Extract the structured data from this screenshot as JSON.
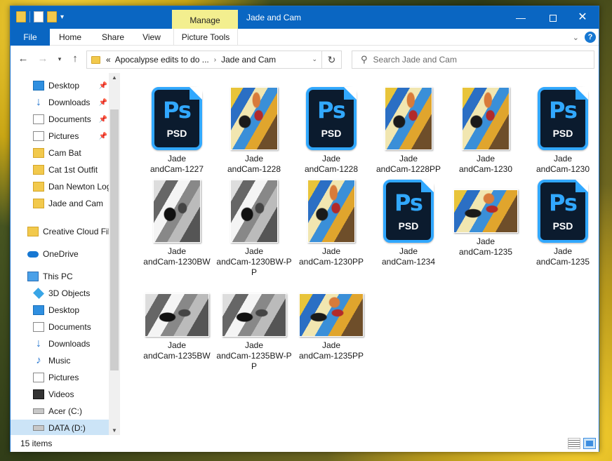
{
  "window": {
    "title": "Jade and Cam",
    "contextual_tab": "Manage"
  },
  "ribbon": {
    "tabs": [
      "File",
      "Home",
      "Share",
      "View",
      "Picture Tools"
    ]
  },
  "address": {
    "overflow": "«",
    "crumbs": [
      "Apocalypse edits to do ...",
      "Jade and Cam"
    ]
  },
  "search": {
    "placeholder": "Search Jade and Cam"
  },
  "nav": {
    "quick_access": [
      {
        "label": "Desktop",
        "icon": "desktop-icon",
        "pinned": true
      },
      {
        "label": "Downloads",
        "icon": "downloads-icon",
        "pinned": true
      },
      {
        "label": "Documents",
        "icon": "documents-icon",
        "pinned": true
      },
      {
        "label": "Pictures",
        "icon": "pictures-icon",
        "pinned": true
      },
      {
        "label": "Cam Bat",
        "icon": "folder-icon",
        "pinned": false
      },
      {
        "label": "Cat 1st Outfit",
        "icon": "folder-icon",
        "pinned": false
      },
      {
        "label": "Dan Newton Log",
        "icon": "folder-icon",
        "pinned": false
      },
      {
        "label": "Jade and Cam",
        "icon": "folder-icon",
        "pinned": false
      }
    ],
    "creative_cloud": "Creative Cloud Fil",
    "onedrive": "OneDrive",
    "this_pc": "This PC",
    "pc_items": [
      {
        "label": "3D Objects",
        "icon": "3d-objects-icon"
      },
      {
        "label": "Desktop",
        "icon": "desktop-icon"
      },
      {
        "label": "Documents",
        "icon": "documents-icon"
      },
      {
        "label": "Downloads",
        "icon": "downloads-icon"
      },
      {
        "label": "Music",
        "icon": "music-icon"
      },
      {
        "label": "Pictures",
        "icon": "pictures-icon"
      },
      {
        "label": "Videos",
        "icon": "videos-icon"
      },
      {
        "label": "Acer (C:)",
        "icon": "drive-icon"
      },
      {
        "label": "DATA (D:)",
        "icon": "drive-icon"
      }
    ]
  },
  "files": [
    {
      "line1": "Jade",
      "line2": "andCam-1227",
      "kind": "psd"
    },
    {
      "line1": "Jade",
      "line2": "andCam-1228",
      "kind": "photo-portrait-color"
    },
    {
      "line1": "Jade",
      "line2": "andCam-1228",
      "kind": "psd"
    },
    {
      "line1": "Jade",
      "line2": "andCam-1228PP",
      "kind": "photo-portrait-color"
    },
    {
      "line1": "Jade",
      "line2": "andCam-1230",
      "kind": "photo-portrait-color"
    },
    {
      "line1": "Jade",
      "line2": "andCam-1230",
      "kind": "psd"
    },
    {
      "line1": "Jade",
      "line2": "andCam-1230BW",
      "kind": "photo-portrait-bw"
    },
    {
      "line1": "Jade",
      "line2": "andCam-1230BW-PP",
      "kind": "photo-portrait-bw"
    },
    {
      "line1": "Jade",
      "line2": "andCam-1230PP",
      "kind": "photo-portrait-color"
    },
    {
      "line1": "Jade",
      "line2": "andCam-1234",
      "kind": "psd"
    },
    {
      "line1": "Jade",
      "line2": "andCam-1235",
      "kind": "photo-landscape-color"
    },
    {
      "line1": "Jade",
      "line2": "andCam-1235",
      "kind": "psd"
    },
    {
      "line1": "Jade",
      "line2": "andCam-1235BW",
      "kind": "photo-landscape-bw"
    },
    {
      "line1": "Jade",
      "line2": "andCam-1235BW-PP",
      "kind": "photo-landscape-bw"
    },
    {
      "line1": "Jade",
      "line2": "andCam-1235PP",
      "kind": "photo-landscape-color"
    }
  ],
  "psd_icon": {
    "glyph": "Ps",
    "text": "PSD"
  },
  "status": {
    "count": "15 items"
  },
  "colors": {
    "accent": "#0a66c2",
    "manage_tab": "#f3ef8f",
    "ps_blue": "#31a8ff",
    "selected": "#cce4f7"
  }
}
